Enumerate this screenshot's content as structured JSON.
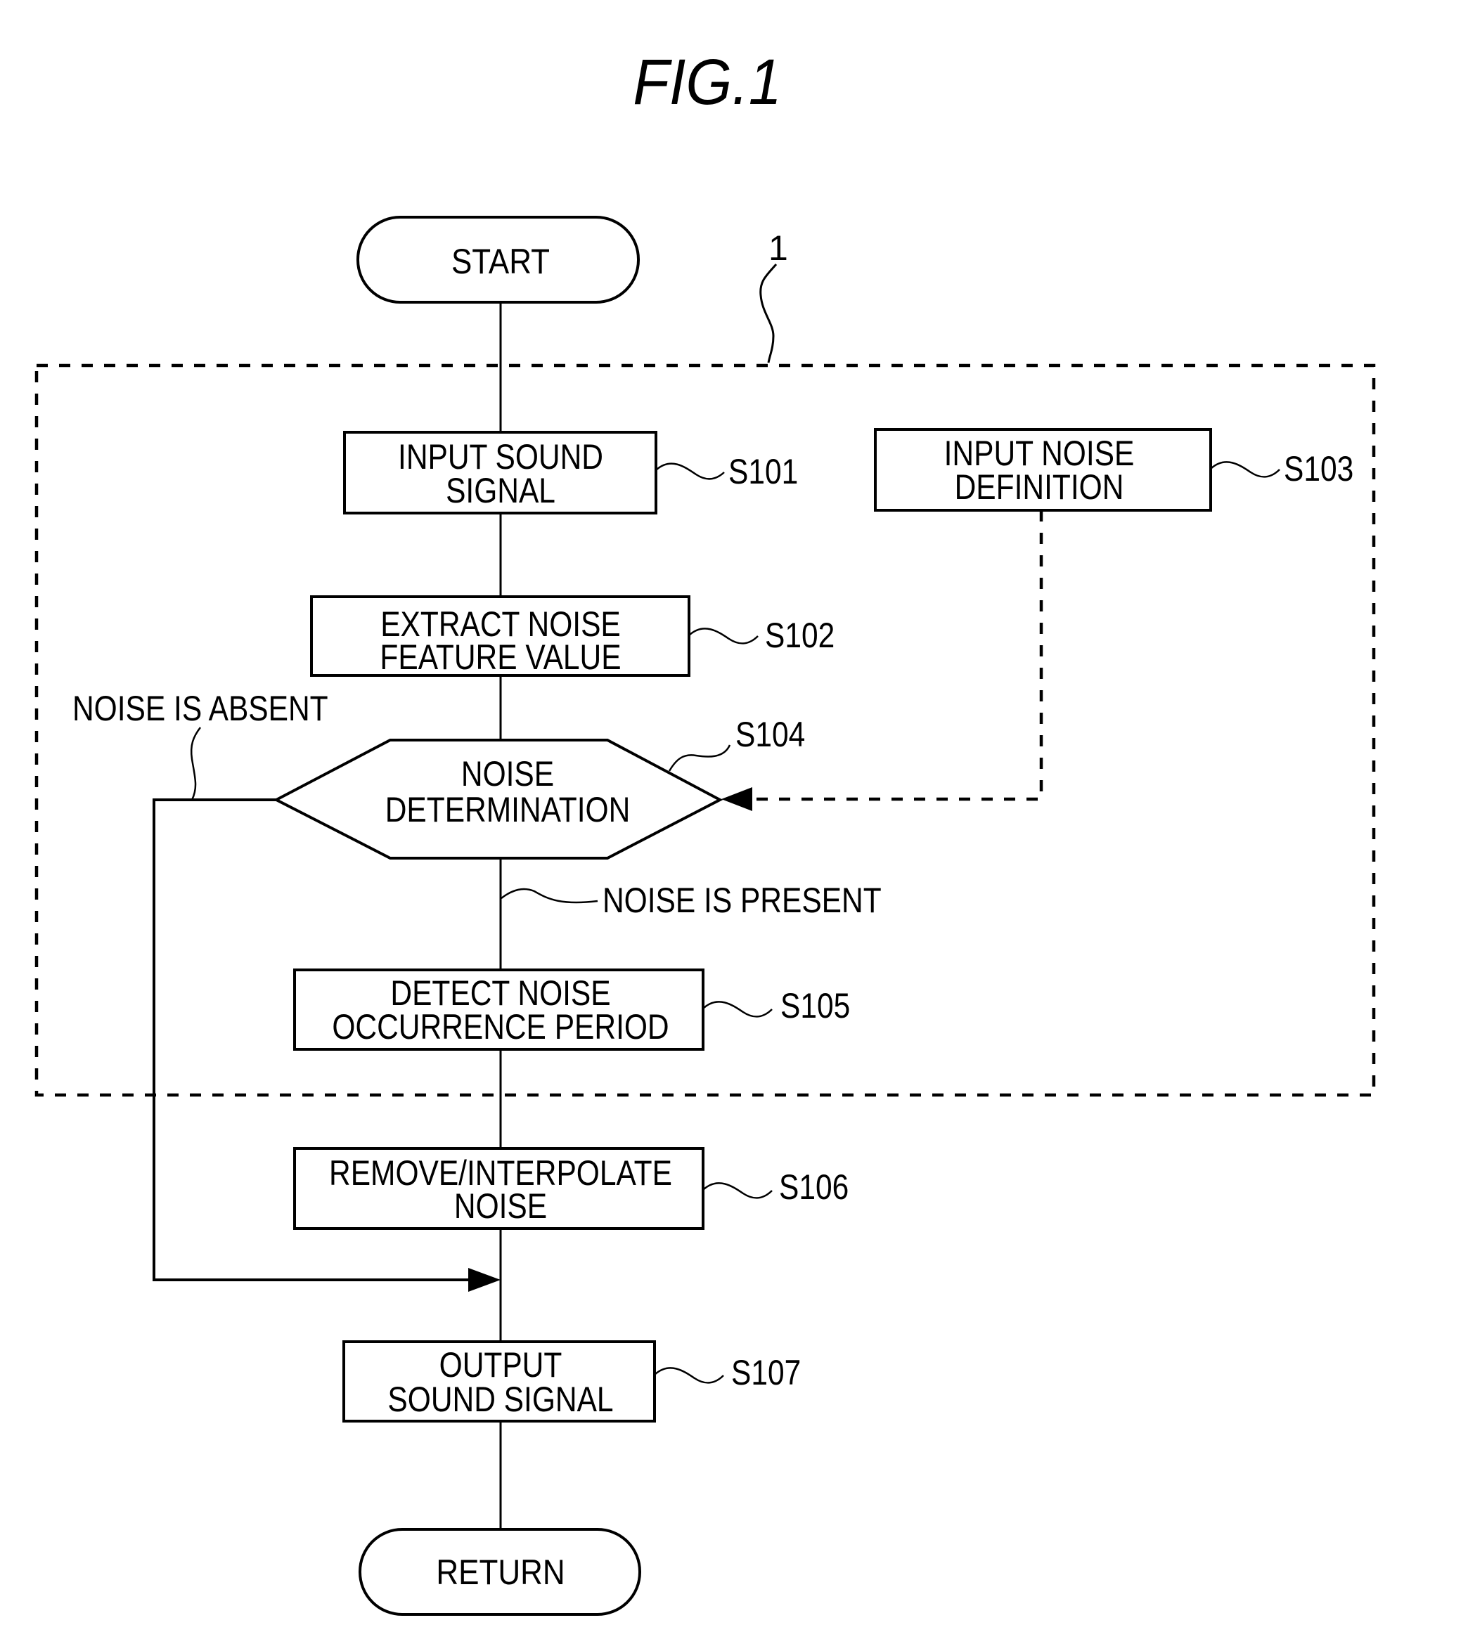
{
  "figure": {
    "title": "FIG.1",
    "reference_numeral": "1",
    "colors": {
      "ink": "#000000",
      "paper": "#ffffff"
    }
  },
  "nodes": {
    "start": {
      "label": "START"
    },
    "s101": {
      "step": "S101",
      "lines": [
        "INPUT SOUND",
        "SIGNAL"
      ]
    },
    "s102": {
      "step": "S102",
      "lines": [
        "EXTRACT NOISE",
        "FEATURE VALUE"
      ]
    },
    "s103": {
      "step": "S103",
      "lines": [
        "INPUT NOISE",
        "DEFINITION"
      ]
    },
    "s104": {
      "step": "S104",
      "lines": [
        "NOISE",
        "DETERMINATION"
      ]
    },
    "s105": {
      "step": "S105",
      "lines": [
        "DETECT NOISE",
        "OCCURRENCE PERIOD"
      ]
    },
    "s106": {
      "step": "S106",
      "lines": [
        "REMOVE/INTERPOLATE",
        "NOISE"
      ]
    },
    "s107": {
      "step": "S107",
      "lines": [
        "OUTPUT",
        "SOUND SIGNAL"
      ]
    },
    "return": {
      "label": "RETURN"
    }
  },
  "branches": {
    "absent": "NOISE IS ABSENT",
    "present": "NOISE IS PRESENT"
  }
}
